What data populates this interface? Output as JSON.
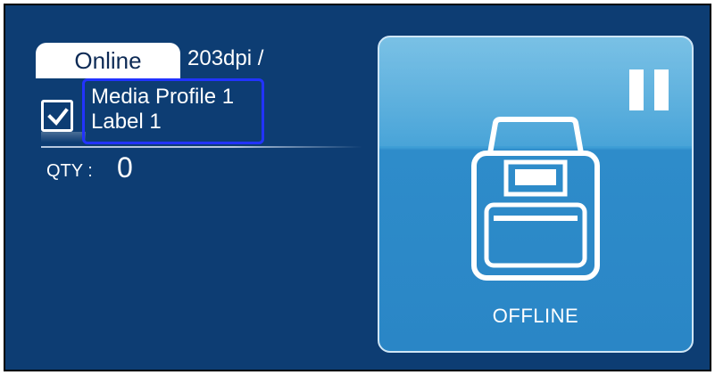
{
  "status": {
    "label": "Online"
  },
  "resolution": {
    "text": "203dpi /"
  },
  "media": {
    "checked": true,
    "profile": "Media Profile 1",
    "label": "Label 1"
  },
  "quantity": {
    "label": "QTY :",
    "value": "0"
  },
  "printer_panel": {
    "state_label": "OFFLINE",
    "icons": [
      "pause-icon",
      "printer-icon"
    ]
  },
  "colors": {
    "background": "#0d3d73",
    "panel": "#2e8cca",
    "selection_border": "#2233ff",
    "text": "#ffffff"
  }
}
